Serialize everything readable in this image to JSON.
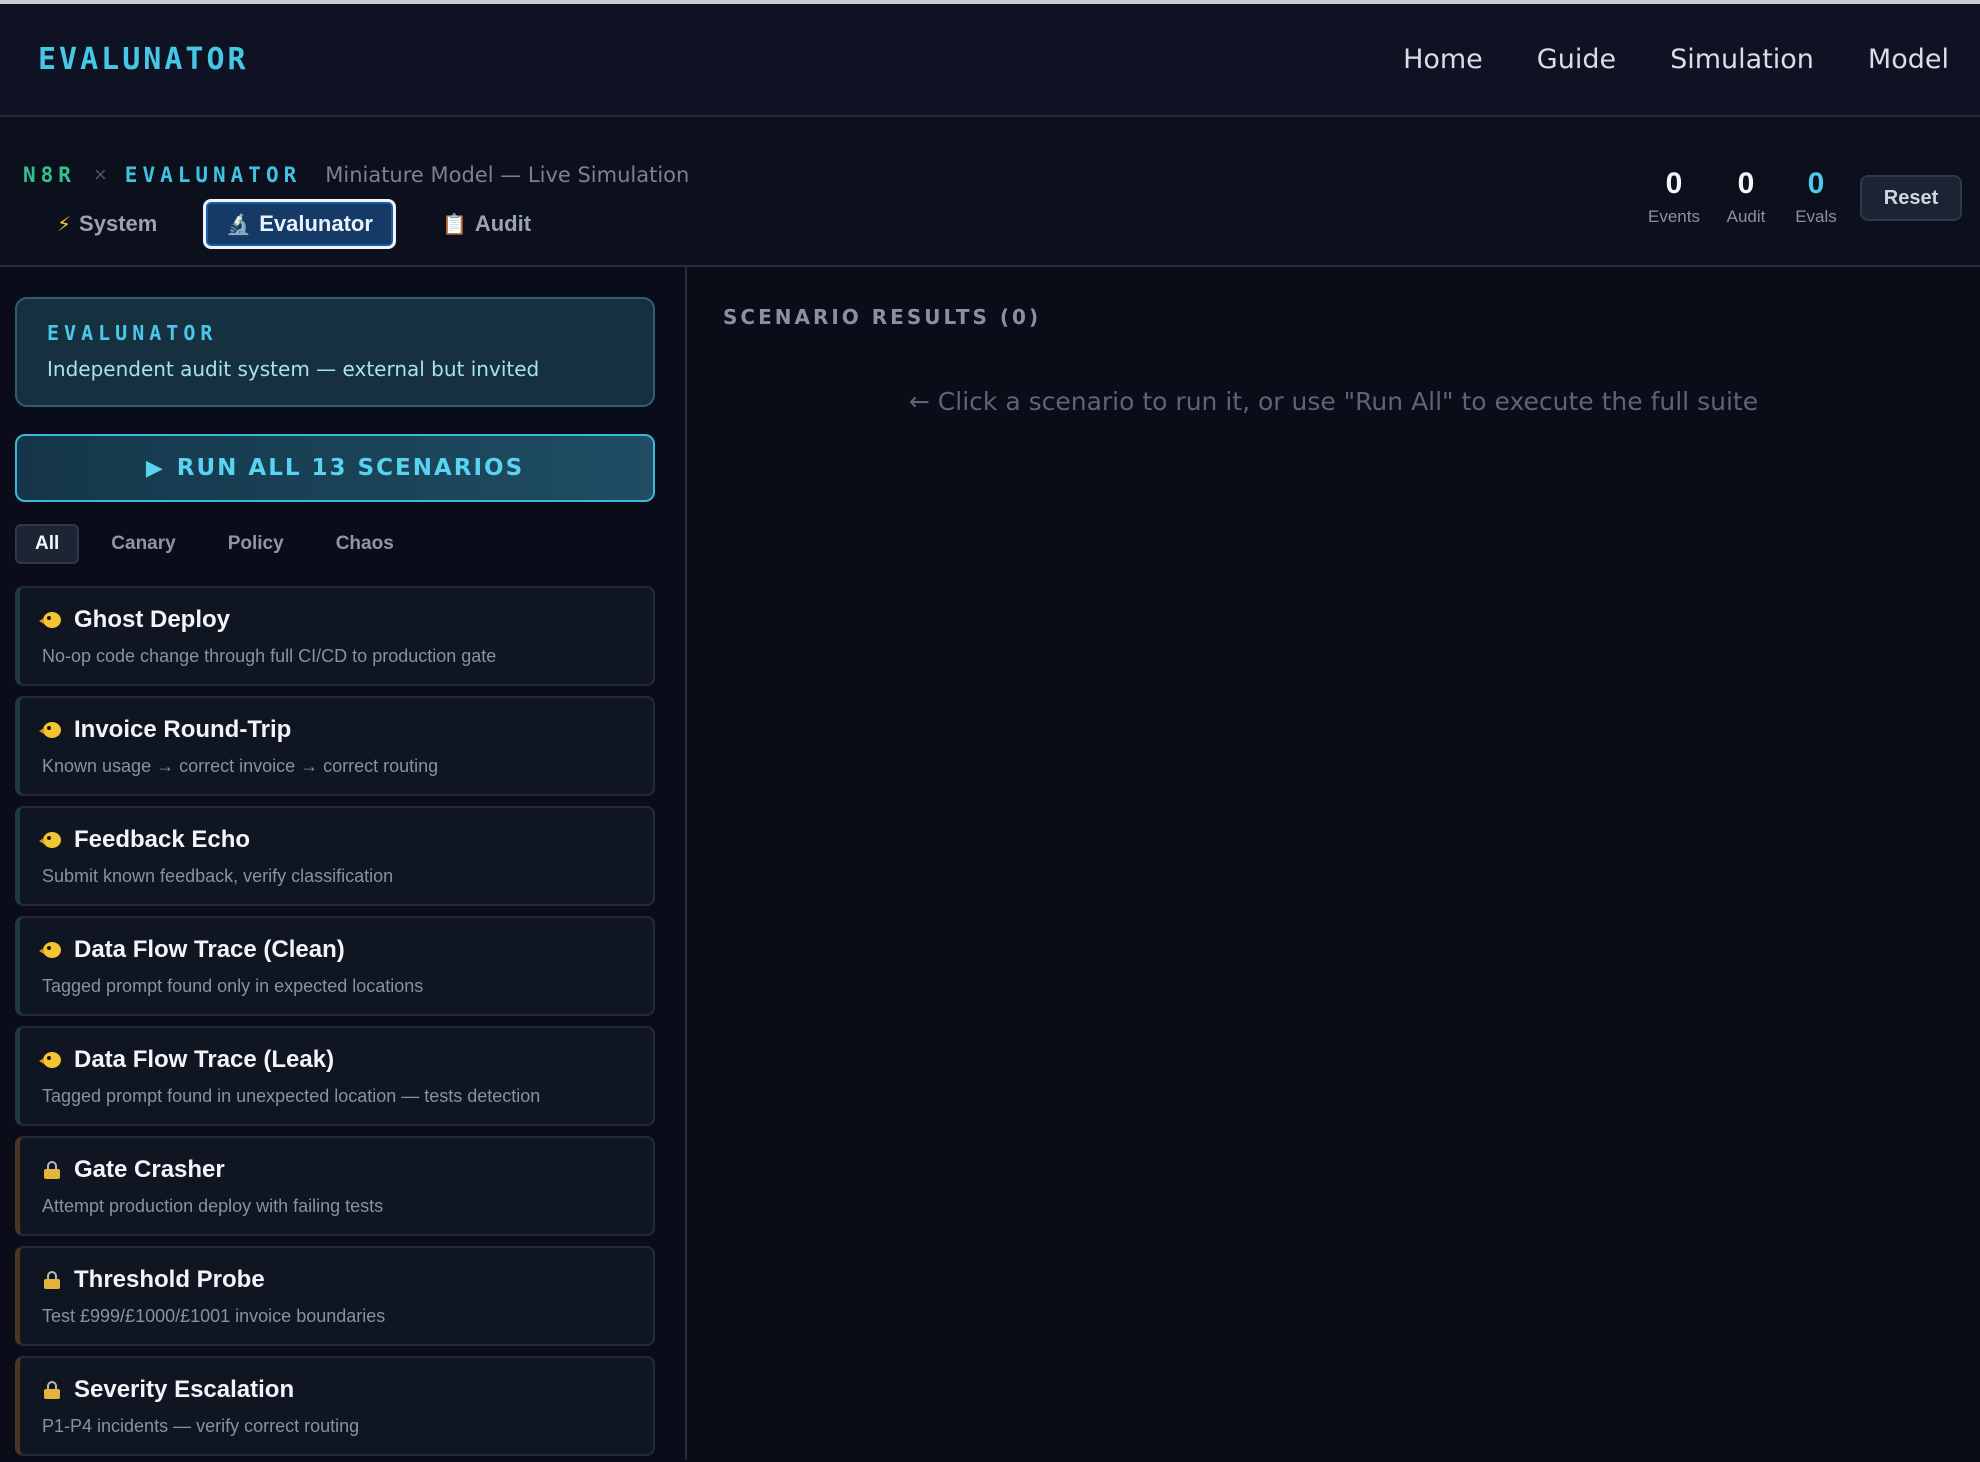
{
  "navbar": {
    "brand": "EVALUNATOR",
    "links": [
      "Home",
      "Guide",
      "Simulation",
      "Model"
    ]
  },
  "subheader": {
    "crumb_left": "N8R",
    "crumb_sep": "×",
    "crumb_right": "EVALUNATOR",
    "subtitle": "Miniature Model — Live Simulation",
    "tabs": [
      {
        "icon": "lightning-icon",
        "label": "System",
        "active": false
      },
      {
        "icon": "microscope-icon",
        "label": "Evalunator",
        "active": true
      },
      {
        "icon": "clipboard-icon",
        "label": "Audit",
        "active": false
      }
    ],
    "stats": [
      {
        "value": "0",
        "label": "Events"
      },
      {
        "value": "0",
        "label": "Audit"
      },
      {
        "value": "0",
        "label": "Evals"
      }
    ],
    "reset_label": "Reset"
  },
  "left": {
    "card_title": "EVALUNATOR",
    "card_sub": "Independent audit system — external but invited",
    "run_all_icon": "▶",
    "run_all_label": "RUN ALL 13 SCENARIOS",
    "filters": [
      "All",
      "Canary",
      "Policy",
      "Chaos"
    ],
    "active_filter": "All",
    "scenarios": [
      {
        "icon": "canary-icon",
        "title": "Ghost Deploy",
        "desc": "No-op code change through full CI/CD to production gate",
        "kind": "canary"
      },
      {
        "icon": "canary-icon",
        "title": "Invoice Round-Trip",
        "desc": "Known usage → correct invoice → correct routing",
        "kind": "canary"
      },
      {
        "icon": "canary-icon",
        "title": "Feedback Echo",
        "desc": "Submit known feedback, verify classification",
        "kind": "canary"
      },
      {
        "icon": "canary-icon",
        "title": "Data Flow Trace (Clean)",
        "desc": "Tagged prompt found only in expected locations",
        "kind": "canary"
      },
      {
        "icon": "canary-icon",
        "title": "Data Flow Trace (Leak)",
        "desc": "Tagged prompt found in unexpected location — tests detection",
        "kind": "canary"
      },
      {
        "icon": "lock-icon",
        "title": "Gate Crasher",
        "desc": "Attempt production deploy with failing tests",
        "kind": "policy"
      },
      {
        "icon": "lock-icon",
        "title": "Threshold Probe",
        "desc": "Test £999/£1000/£1001 invoice boundaries",
        "kind": "policy"
      },
      {
        "icon": "lock-icon",
        "title": "Severity Escalation",
        "desc": "P1-P4 incidents — verify correct routing",
        "kind": "policy"
      }
    ]
  },
  "right": {
    "heading": "SCENARIO RESULTS (0)",
    "hint": "← Click a scenario to run it, or use \"Run All\" to execute the full suite"
  }
}
